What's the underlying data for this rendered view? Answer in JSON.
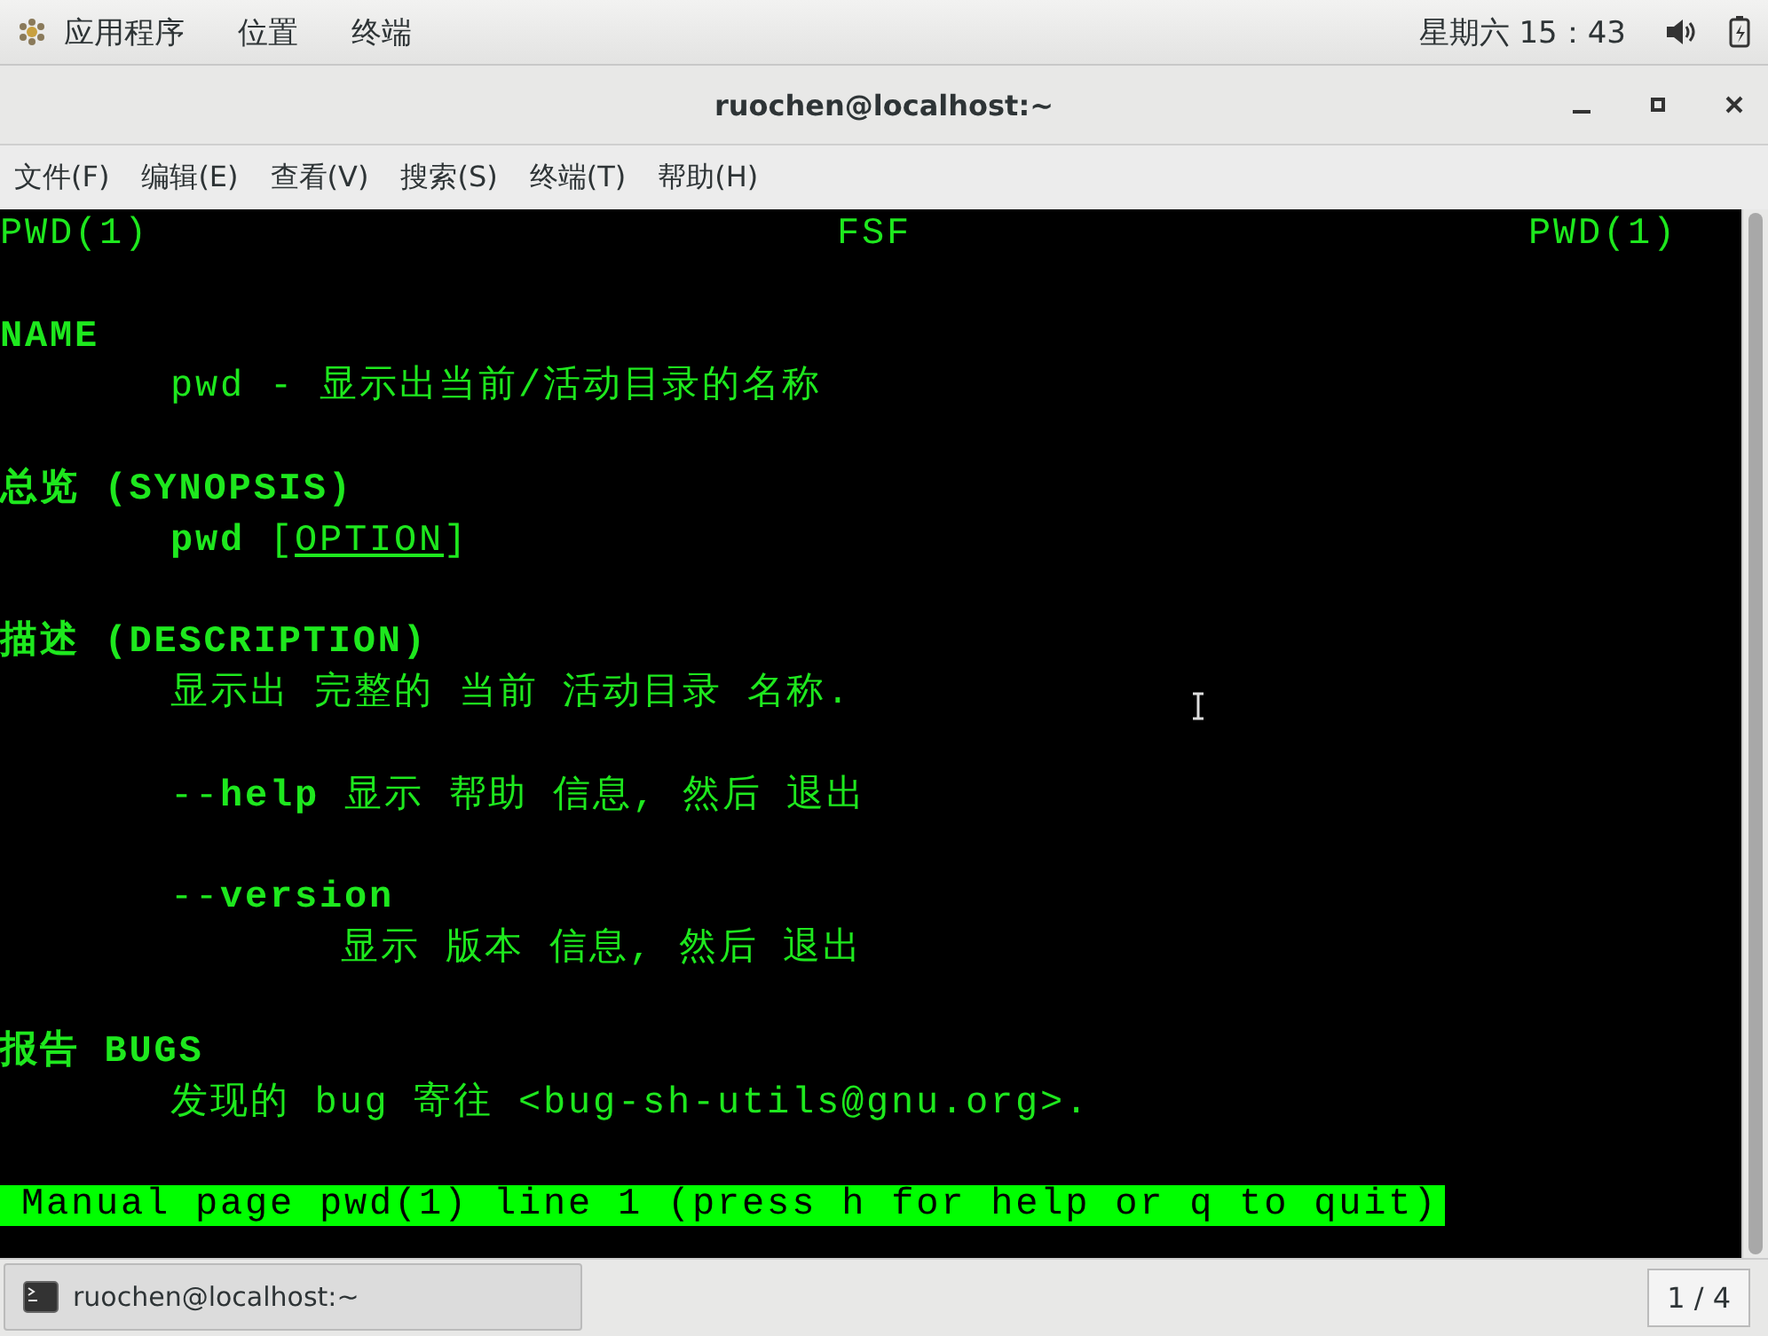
{
  "top_panel": {
    "menus": [
      "应用程序",
      "位置",
      "终端"
    ],
    "clock": "星期六 15：43"
  },
  "window": {
    "title": "ruochen@localhost:~"
  },
  "menu_bar": [
    "文件(F)",
    "编辑(E)",
    "查看(V)",
    "搜索(S)",
    "终端(T)",
    "帮助(H)"
  ],
  "terminal": {
    "lines": [
      {
        "kind": "header",
        "left": "PWD(1)",
        "center": "FSF",
        "right": "PWD(1)"
      },
      {
        "kind": "blank"
      },
      {
        "kind": "heading",
        "text": "NAME"
      },
      {
        "kind": "body",
        "text": "pwd - 显示出当前/活动目录的名称"
      },
      {
        "kind": "blank"
      },
      {
        "kind": "heading",
        "text": "总览 (SYNOPSIS)"
      },
      {
        "kind": "synopsis",
        "text": "**pwd** [",
        "option": "OPTION",
        "after": "]"
      },
      {
        "kind": "blank"
      },
      {
        "kind": "heading",
        "text": "描述 (DESCRIPTION)"
      },
      {
        "kind": "body",
        "text": "显示出 完整的 当前 活动目录 名称."
      },
      {
        "kind": "blank"
      },
      {
        "kind": "body",
        "text": "--**help** 显示 帮助 信息, 然后 退出"
      },
      {
        "kind": "blank"
      },
      {
        "kind": "body",
        "text": "--**version**"
      },
      {
        "kind": "subbody",
        "text": "显示 版本 信息, 然后 退出"
      },
      {
        "kind": "blank"
      },
      {
        "kind": "heading",
        "text": "报告 BUGS"
      },
      {
        "kind": "body",
        "text": "发现的 bug 寄往 <bug-sh-utils@gnu.org>."
      },
      {
        "kind": "blank"
      }
    ],
    "status": "Manual page pwd(1) line 1 (press h for help or q to quit)"
  },
  "taskbar": {
    "window_button": "ruochen@localhost:~",
    "workspace": "1 / 4"
  }
}
